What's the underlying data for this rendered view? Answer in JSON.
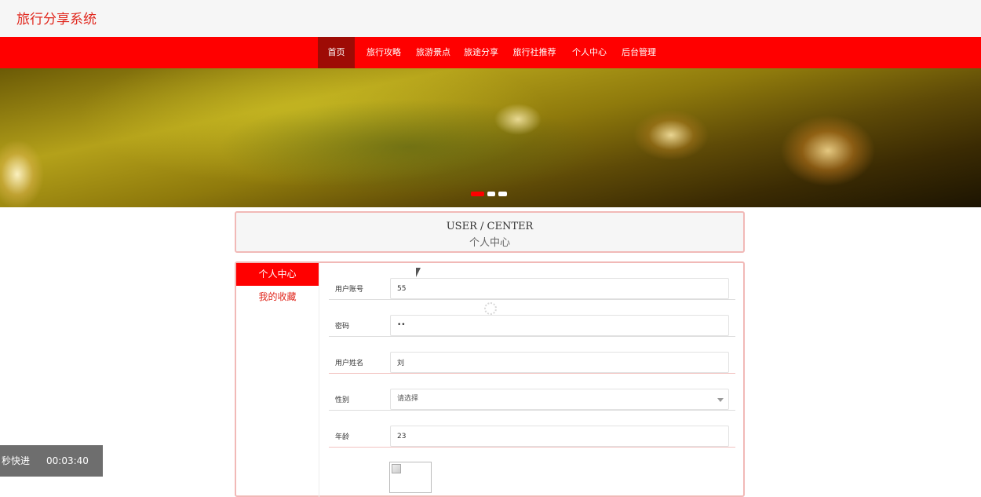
{
  "header": {
    "site_title": "旅行分享系统"
  },
  "nav": {
    "items": [
      {
        "label": "首页",
        "active": true
      },
      {
        "label": "旅行攻略"
      },
      {
        "label": "旅游景点"
      },
      {
        "label": "旅途分享"
      },
      {
        "label": "旅行社推荐"
      },
      {
        "label": "个人中心"
      },
      {
        "label": "后台管理"
      }
    ]
  },
  "banner": {
    "slide_count": 3,
    "active_slide": 1
  },
  "user_center": {
    "title_en": "USER / CENTER",
    "title_cn": "个人中心"
  },
  "sidebar": {
    "items": [
      {
        "label": "个人中心",
        "active": true
      },
      {
        "label": "我的收藏"
      }
    ]
  },
  "form": {
    "fields": [
      {
        "label": "用户账号",
        "value": "55"
      },
      {
        "label": "密码",
        "value": "••"
      },
      {
        "label": "用户姓名",
        "value": "刘"
      },
      {
        "label": "性别",
        "value": "请选择"
      },
      {
        "label": "年龄",
        "value": "23"
      }
    ]
  },
  "overlay": {
    "timer_label": "秒快进",
    "timer_time": "00:03:40"
  },
  "colors": {
    "accent": "#ff0000",
    "nav_active": "#9e0b05",
    "title_red": "#e0261c",
    "panel_border": "#f1b9b7"
  }
}
